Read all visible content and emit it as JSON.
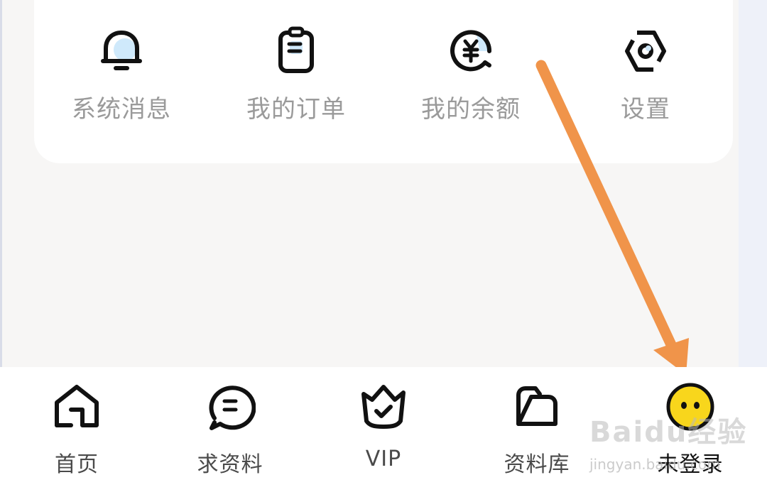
{
  "menu": {
    "items": [
      {
        "label": "系统消息",
        "icon": "bell-icon"
      },
      {
        "label": "我的订单",
        "icon": "clipboard-icon"
      },
      {
        "label": "我的余额",
        "icon": "yen-coin-icon"
      },
      {
        "label": "设置",
        "icon": "gear-hexagon-icon"
      }
    ]
  },
  "tabbar": {
    "items": [
      {
        "label": "首页",
        "icon": "home-icon"
      },
      {
        "label": "求资料",
        "icon": "chat-bubble-icon"
      },
      {
        "label": "VIP",
        "icon": "crown-icon"
      },
      {
        "label": "资料库",
        "icon": "folder-icon"
      },
      {
        "label": "未登录",
        "icon": "avatar-face-icon"
      }
    ]
  },
  "watermark": {
    "text": "Baidu经验",
    "url": "jingyan.baidu.com"
  },
  "colors": {
    "accent_light_blue": "#cfe9fb",
    "arrow_orange": "#f0944a",
    "avatar_yellow": "#f8d61c",
    "label_gray": "#9a9a9a"
  }
}
